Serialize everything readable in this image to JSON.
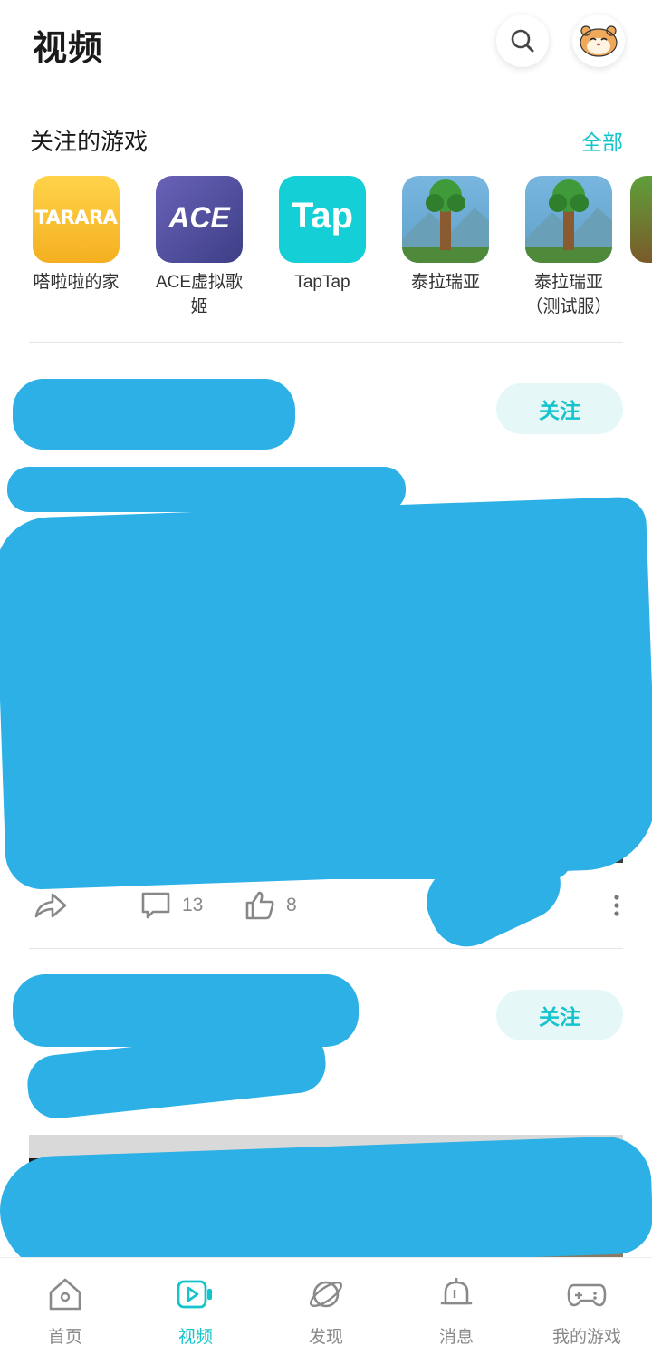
{
  "header": {
    "title": "视频",
    "search_icon": "search-icon",
    "avatar_icon": "hamster-avatar"
  },
  "followed_games": {
    "title": "关注的游戏",
    "all_label": "全部",
    "items": [
      {
        "name": "嗒啦啦的家",
        "icon_text": "TARARA",
        "icon": "tarara-icon"
      },
      {
        "name": "ACE虚拟歌姬",
        "icon_text": "ACE",
        "icon": "ace-icon"
      },
      {
        "name": "TapTap",
        "icon_text": "Tap",
        "icon": "taptap-icon"
      },
      {
        "name": "泰拉瑞亚",
        "icon": "terraria-tree-icon"
      },
      {
        "name": "泰拉瑞亚（测试服）",
        "icon": "terraria-tree-icon"
      }
    ]
  },
  "posts": [
    {
      "follow_label": "关注",
      "comments": "13",
      "likes": "8"
    },
    {
      "follow_label": "关注"
    }
  ],
  "tab_bar": {
    "items": [
      {
        "label": "首页",
        "icon": "home-icon"
      },
      {
        "label": "视频",
        "icon": "video-icon",
        "active": true
      },
      {
        "label": "发现",
        "icon": "planet-icon"
      },
      {
        "label": "消息",
        "icon": "bell-icon"
      },
      {
        "label": "我的游戏",
        "icon": "gamepad-icon"
      }
    ]
  },
  "colors": {
    "accent": "#14c4cc",
    "follow_bg": "#e5f7f7",
    "redaction": "#2cb0e6"
  }
}
